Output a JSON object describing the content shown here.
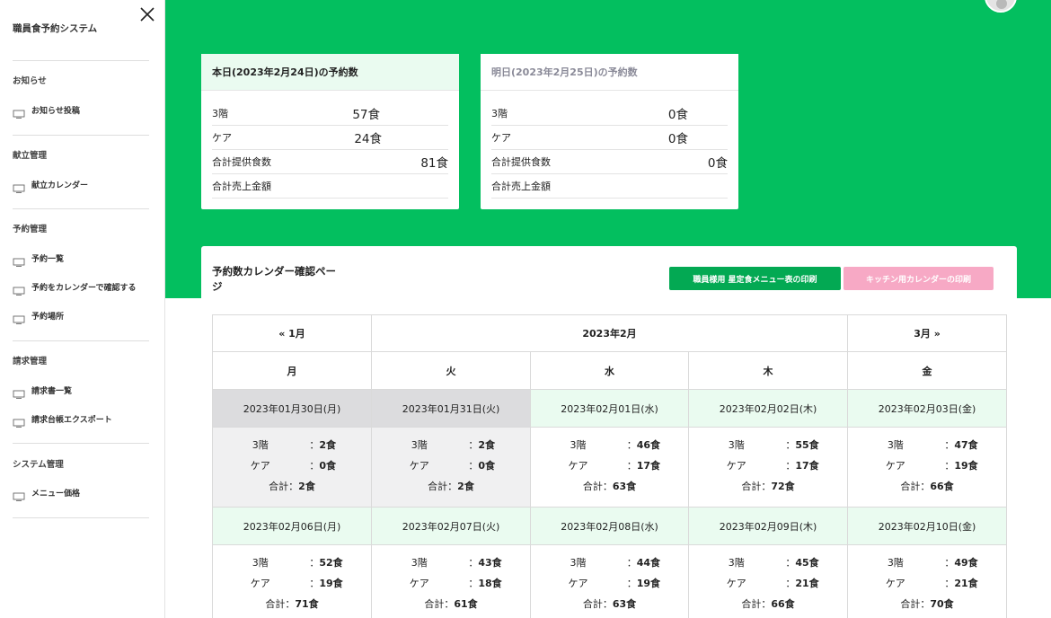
{
  "sidebar": {
    "app_title": "職員食予約システム",
    "sections": [
      {
        "title": "お知らせ",
        "items": [
          "お知らせ投稿"
        ]
      },
      {
        "title": "献立管理",
        "items": [
          "献立カレンダー"
        ]
      },
      {
        "title": "予約管理",
        "items": [
          "予約一覧",
          "予約をカレンダーで確認する",
          "予約場所"
        ]
      },
      {
        "title": "請求管理",
        "items": [
          "請求書一覧",
          "請求台帳エクスポート"
        ]
      },
      {
        "title": "システム管理",
        "items": [
          "メニュー価格"
        ]
      }
    ]
  },
  "today_card": {
    "title": "本日(2023年2月24日)の予約数",
    "rows": [
      {
        "label": "3階",
        "value": "57食"
      },
      {
        "label": "ケア",
        "value": "24食"
      },
      {
        "label": "合計提供食数",
        "value": "81食"
      },
      {
        "label": "合計売上金額",
        "value": ""
      }
    ]
  },
  "tomorrow_card": {
    "title": "明日(2023年2月25日)の予約数",
    "rows": [
      {
        "label": "3階",
        "value": "0食"
      },
      {
        "label": "ケア",
        "value": "0食"
      },
      {
        "label": "合計提供食数",
        "value": "0食"
      },
      {
        "label": "合計売上金額",
        "value": ""
      }
    ]
  },
  "calendar": {
    "title": "予約数カレンダー確認ページ",
    "print_staff_button": "職員様用 星定食メニュー表の印刷",
    "print_kitchen_button": "キッチン用カレンダーの印刷",
    "prev_month": "« 1月",
    "current_month": "2023年2月",
    "next_month": "3月 »",
    "weekdays": [
      "月",
      "火",
      "水",
      "木",
      "金"
    ],
    "label_floor": "3階",
    "label_care": "ケア",
    "label_total": "合計：",
    "colon": "：",
    "weeks": [
      [
        {
          "date": "2023年01月30日(月)",
          "floor": "2食",
          "care": "0食",
          "total": "2食",
          "in_month": false
        },
        {
          "date": "2023年01月31日(火)",
          "floor": "2食",
          "care": "0食",
          "total": "2食",
          "in_month": false
        },
        {
          "date": "2023年02月01日(水)",
          "floor": "46食",
          "care": "17食",
          "total": "63食",
          "in_month": true
        },
        {
          "date": "2023年02月02日(木)",
          "floor": "55食",
          "care": "17食",
          "total": "72食",
          "in_month": true
        },
        {
          "date": "2023年02月03日(金)",
          "floor": "47食",
          "care": "19食",
          "total": "66食",
          "in_month": true
        }
      ],
      [
        {
          "date": "2023年02月06日(月)",
          "floor": "52食",
          "care": "19食",
          "total": "71食",
          "in_month": true
        },
        {
          "date": "2023年02月07日(火)",
          "floor": "43食",
          "care": "18食",
          "total": "61食",
          "in_month": true
        },
        {
          "date": "2023年02月08日(水)",
          "floor": "44食",
          "care": "19食",
          "total": "63食",
          "in_month": true
        },
        {
          "date": "2023年02月09日(木)",
          "floor": "45食",
          "care": "21食",
          "total": "66食",
          "in_month": true
        },
        {
          "date": "2023年02月10日(金)",
          "floor": "49食",
          "care": "21食",
          "total": "70食",
          "in_month": true
        }
      ]
    ]
  },
  "colors": {
    "brand_green": "#03bf5f",
    "button_green": "#03a953",
    "button_pink": "#f7a9c5",
    "in_month_date_bg": "#eafbf0",
    "out_month_date_bg": "#dcdcde"
  },
  "icons": {
    "close": "close-icon",
    "nav_item": "monitor-icon",
    "avatar": "user-avatar"
  }
}
